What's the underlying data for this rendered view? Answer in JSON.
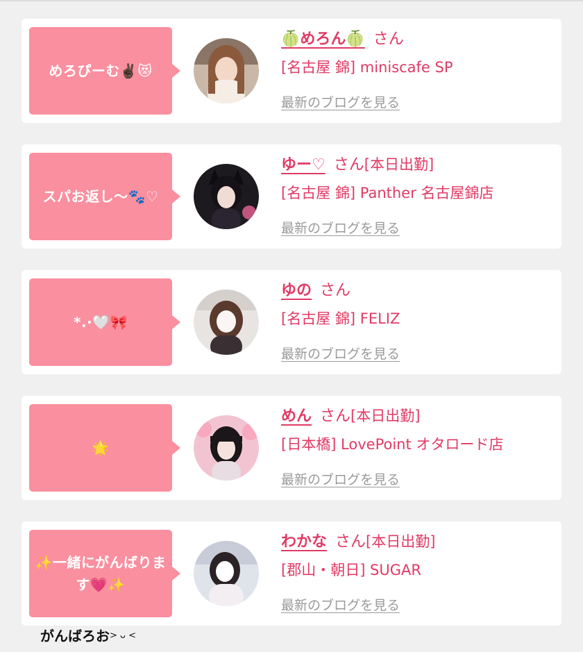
{
  "colors": {
    "accent": "#e03a64",
    "bubble": "#f98f9f",
    "link_gray": "#9a9a9a",
    "card": "#ffffff",
    "background": "#f0f0f0"
  },
  "entries": [
    {
      "message": "めろぴーむ✌🏿😻",
      "name": "🍈めろん🍈",
      "honorific": "さん",
      "status": "",
      "shop": "[名古屋 錦] miniscafe SP",
      "blog_link": "最新のブログを見る"
    },
    {
      "message": "スパお返し〜🐾♡",
      "name": "ゆー♡",
      "honorific": "さん",
      "status": "[本日出勤]",
      "shop": "[名古屋 錦] Panther 名古屋錦店",
      "blog_link": "最新のブログを見る"
    },
    {
      "message": "*.·🤍🎀",
      "name": "ゆの",
      "honorific": "さん",
      "status": "",
      "shop": "[名古屋 錦] FELIZ",
      "blog_link": "最新のブログを見る"
    },
    {
      "message": "🌟",
      "name": "めん",
      "honorific": "さん",
      "status": "[本日出勤]",
      "shop": "[日本橋] LovePoint オタロード店",
      "blog_link": "最新のブログを見る"
    },
    {
      "message": "✨一緒にがんばります💗✨",
      "name": "わかな",
      "honorific": "さん",
      "status": "[本日出勤]",
      "shop": "[郡山・朝日] SUGAR",
      "blog_link": "最新のブログを見る"
    }
  ],
  "caption": {
    "main": "がんばろお",
    "face": "> ᴗ <"
  }
}
